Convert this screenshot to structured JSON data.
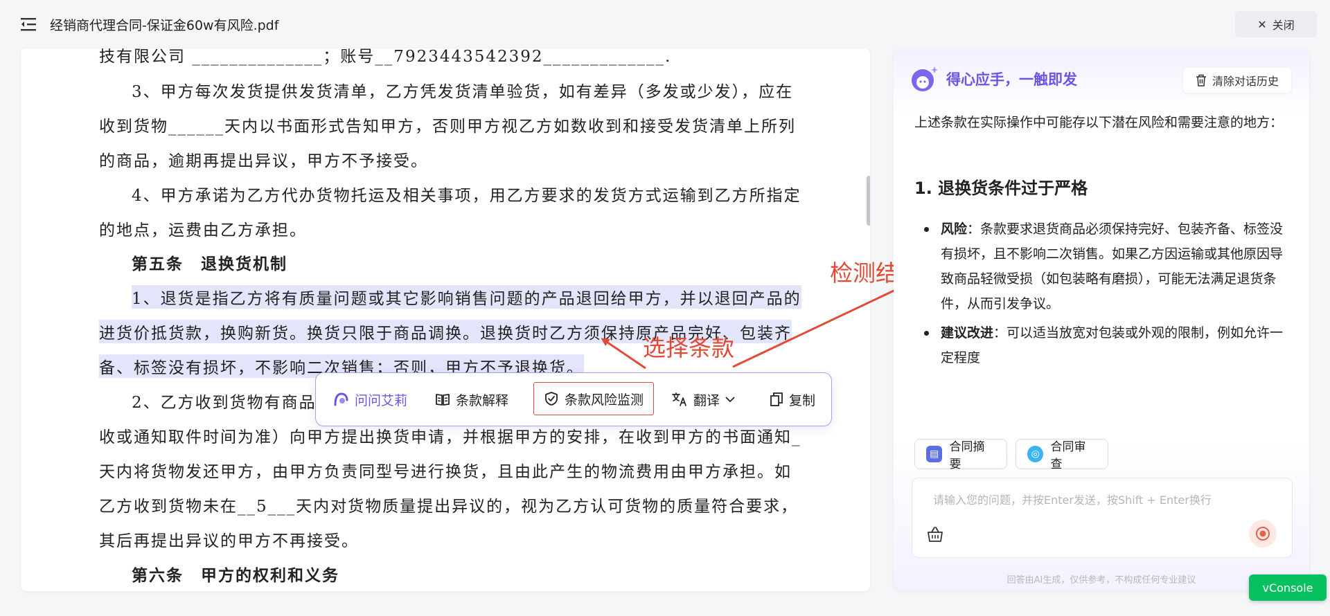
{
  "header": {
    "file_title": "经销商代理合同-保证金60w有风险.pdf",
    "close_label": "关闭"
  },
  "document": {
    "lines": [
      {
        "text": "技有限公司 ______________；账号__7923443542392_____________.",
        "highlight": false,
        "heading": false
      },
      {
        "text": "3、甲方每次发货提供发货清单，乙方凭发货清单验货，如有差异（多发或少发），应在",
        "highlight": false,
        "heading": false
      },
      {
        "text": "收到货物______天内以书面形式告知甲方，否则甲方视乙方如数收到和接受发货清单上所列",
        "highlight": false,
        "heading": false
      },
      {
        "text": "的商品，逾期再提出异议，甲方不予接受。",
        "highlight": false,
        "heading": false
      },
      {
        "text": "4、甲方承诺为乙方代办货物托运及相关事项，用乙方要求的发货方式运输到乙方所指定",
        "highlight": false,
        "heading": false
      },
      {
        "text": "的地点，运费由乙方承担。",
        "highlight": false,
        "heading": false
      },
      {
        "text": "第五条　退换货机制",
        "highlight": false,
        "heading": true
      },
      {
        "text": "1、退货是指乙方将有质量问题或其它影响销售问题的产品退回给甲方，并以退回产品的",
        "highlight": true,
        "heading": false
      },
      {
        "text": "进货价抵货款，换购新货。换货只限于商品调换。退换货时乙方须保持原产品完好、包装齐",
        "highlight": true,
        "heading": false
      },
      {
        "text": "备、标签没有损坏，不影响二次销售；否则，甲方不予退换货。",
        "highlight": true,
        "heading": false
      },
      {
        "text": "2、乙方收到货物有商品",
        "highlight": false,
        "heading": false
      },
      {
        "text": "收或通知取件时间为准）向甲方提出换货申请，并根据甲方的安排，在收到甲方的书面通知_",
        "highlight": false,
        "heading": false
      },
      {
        "text": "天内将货物发还甲方，由甲方负责同型号进行换货，且由此产生的物流费用由甲方承担。如",
        "highlight": false,
        "heading": false
      },
      {
        "text": "乙方收到货物未在__5___天内对货物质量提出异议的，视为乙方认可货物的质量符合要求，",
        "highlight": false,
        "heading": false
      },
      {
        "text": "其后再提出异议的甲方不再接受。",
        "highlight": false,
        "heading": false
      },
      {
        "text": "第六条　甲方的权利和义务",
        "highlight": false,
        "heading": true
      }
    ]
  },
  "toolbar": {
    "ask": "问问艾莉",
    "explain": "条款解释",
    "risk": "条款风险监测",
    "translate": "翻译",
    "copy": "复制"
  },
  "annotations": {
    "select": "选择条款",
    "result": "检测结果",
    "color": "#e34a35"
  },
  "panel": {
    "brand": "得心应手，一触即发",
    "clear_label": "清除对话历史",
    "intro": "上述条款在实际操作中可能存以下潜在风险和需要注意的地方：",
    "section_title": "1. 退换货条件过于严格",
    "bullets": [
      {
        "label": "风险",
        "text": "：条款要求退货商品必须保持完好、包装齐备、标签没有损坏，且不影响二次销售。如果乙方因运输或其他原因导致商品轻微受损（如包装略有磨损），可能无法满足退货条件，从而引发争议。"
      },
      {
        "label": "建议改进",
        "text": "：可以适当放宽对包装或外观的限制，例如允许一定程度"
      }
    ],
    "quick_actions": [
      "合同摘要",
      "合同审查"
    ],
    "input_placeholder": "请输入您的问题，并按Enter发送，按Shift + Enter换行",
    "disclaimer": "回答由AI生成，仅供参考，不构成任何专业建议"
  },
  "vconsole": "vConsole",
  "colors": {
    "accent": "#6a55e8",
    "highlight": "#e3e5fb",
    "vconsole": "#07c160"
  }
}
